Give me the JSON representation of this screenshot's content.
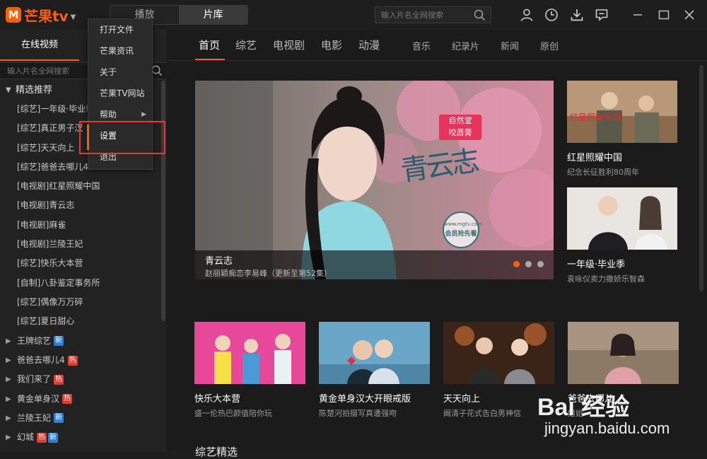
{
  "app": {
    "logo_text": "芒果tv",
    "logo_mark": "M"
  },
  "mode_tabs": [
    {
      "label": "播放"
    },
    {
      "label": "片库"
    }
  ],
  "top_search": {
    "placeholder": "输入片名全网搜索"
  },
  "sidebar": {
    "tab_label": "在线视频",
    "search_placeholder": "输入片名全网搜索",
    "group_label": "精选推荐",
    "items": [
      {
        "label": "[综艺]一年级·毕业季"
      },
      {
        "label": "[综艺]真正男子汉"
      },
      {
        "label": "[综艺]天天向上"
      },
      {
        "label": "[综艺]爸爸去哪儿4"
      },
      {
        "label": "[电视剧]红星照耀中国"
      },
      {
        "label": "[电视剧]青云志"
      },
      {
        "label": "[电视剧]麻雀"
      },
      {
        "label": "[电视剧]兰陵王妃"
      },
      {
        "label": "[综艺]快乐大本营"
      },
      {
        "label": "[自制]八卦鉴定事务所"
      },
      {
        "label": "[综艺]偶像万万碎"
      },
      {
        "label": "[综艺]夏日甜心"
      }
    ],
    "categories": [
      {
        "label": "王牌综艺",
        "badges": [
          "新"
        ]
      },
      {
        "label": "爸爸去哪儿4",
        "badges": [
          "热"
        ]
      },
      {
        "label": "我们来了",
        "badges": [
          "热"
        ]
      },
      {
        "label": "黄金单身汉",
        "badges": [
          "热"
        ]
      },
      {
        "label": "兰陵王妃",
        "badges": [
          "新"
        ]
      },
      {
        "label": "幻城",
        "badges": [
          "热",
          "新"
        ]
      }
    ]
  },
  "nav": {
    "primary": [
      "首页",
      "综艺",
      "电视剧",
      "电影",
      "动漫"
    ],
    "secondary": [
      "音乐",
      "纪录片",
      "新闻",
      "原创"
    ],
    "active": "首页"
  },
  "hero": {
    "title": "青云志",
    "subtitle": "赵丽颖痴恋李易峰（更新至第52集）",
    "art_title": "青云志",
    "sponsor_line1": "自然堂",
    "sponsor_line2": "咬唇膏",
    "stamp_text": "会员抢先看",
    "stamp_site": "www.mgtv.com",
    "slide_count": 3,
    "active_slide": 1
  },
  "side_cards": [
    {
      "title": "红星照耀中国",
      "subtitle": "纪念长征胜利80周年",
      "art_text": "红星照耀中国"
    },
    {
      "title": "一年级·毕业季",
      "subtitle": "袁咏仪卖力撒娇乐智森"
    }
  ],
  "row_cards": [
    {
      "title": "快乐大本营",
      "subtitle": "盛一伦热巴颜值陪你玩"
    },
    {
      "title": "黄金单身汉大开眼戒版",
      "subtitle": "陈楚河拍摄写真遭强吻"
    },
    {
      "title": "天天向上",
      "subtitle": "阚清子花式告白男神信"
    },
    {
      "title": "爸爸去哪儿",
      "subtitle": "姐姐"
    }
  ],
  "section_heading": "综艺精选",
  "menu": {
    "items": [
      {
        "label": "打开文件",
        "has_sub": false
      },
      {
        "label": "芒果资讯",
        "has_sub": false
      },
      {
        "label": "关于",
        "has_sub": false
      },
      {
        "label": "芒果TV网站",
        "has_sub": false
      },
      {
        "label": "帮助",
        "has_sub": true
      },
      {
        "label": "设置",
        "has_sub": false
      },
      {
        "label": "退出",
        "has_sub": false
      }
    ],
    "highlighted": "设置"
  },
  "watermark": {
    "logo": "Bai 经验",
    "url": "jingyan.baidu.com"
  },
  "colors": {
    "accent": "#ff5f00",
    "new_badge": "#2b7fd6",
    "hot_badge": "#e53a2f",
    "highlight_box": "#e53a2f"
  },
  "icons": [
    "user-icon",
    "history-icon",
    "download-icon",
    "message-icon",
    "minimize-icon",
    "maximize-icon",
    "close-icon",
    "search-icon"
  ]
}
